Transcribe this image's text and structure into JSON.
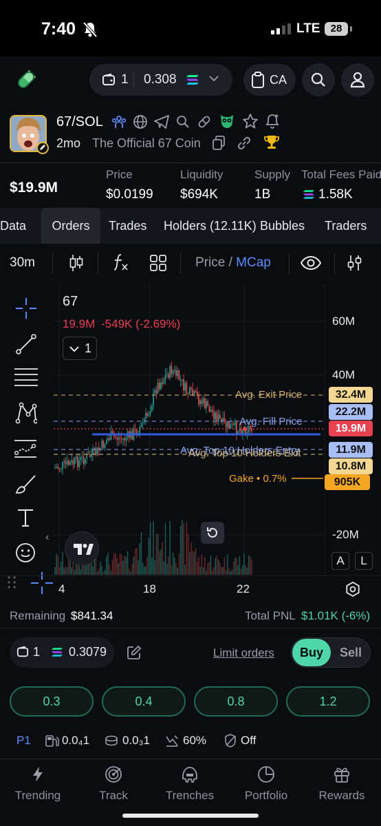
{
  "status_bar": {
    "time": "7:40",
    "network": "LTE",
    "battery": "28"
  },
  "top_bar": {
    "wallet_count": "1",
    "sol_balance": "0.308",
    "ca_label": "CA"
  },
  "token": {
    "pair": "67/SOL",
    "age": "2mo",
    "name": "The Official 67 Coin"
  },
  "stats": {
    "market_cap": "$19.9M",
    "price_label": "Price",
    "price": "$0.0199",
    "liquidity_label": "Liquidity",
    "liquidity": "$694K",
    "supply_label": "Supply",
    "supply": "1B",
    "fees_label": "Total Fees Paid",
    "fees": "1.58K"
  },
  "tabs": [
    "Data",
    "Orders",
    "Trades",
    "Holders (12.11K)",
    "Bubbles",
    "Traders"
  ],
  "toolbar": {
    "interval": "30m",
    "price_label": "Price",
    "slash": "/",
    "mcap_label": "MCap"
  },
  "chart": {
    "symbol": "67",
    "mcap_value": "19.9M",
    "change": "-549K (-2.69%)",
    "indicator_count": "1",
    "y_ticks": [
      "60M",
      "40M",
      "-20M"
    ],
    "x_ticks": [
      "4",
      "18",
      "22"
    ],
    "lines": [
      {
        "label": "Avg. Exit Price",
        "value": "32.4M",
        "color": "#e8c36a"
      },
      {
        "label": "Avg. Fill Price",
        "value": "22.2M",
        "color": "#8aa4f0"
      },
      {
        "label": "",
        "value": "19.9M",
        "color": "#e8414f"
      },
      {
        "label": "Avg. Top 10 Holders Entry",
        "value": "11.9M",
        "color": "#8aa4f0"
      },
      {
        "label": "Avg. Top 10 Holders Exit",
        "value": "10.8M",
        "color": "#f3d792"
      },
      {
        "label": "Gake • 0.7%",
        "value": "905K",
        "color": "#f5a623"
      }
    ],
    "auto_label": "A",
    "log_label": "L"
  },
  "position": {
    "remaining_label": "Remaining",
    "remaining": "$841.34",
    "pnl_label": "Total PNL",
    "pnl": "$1.01K (-6%)"
  },
  "trade": {
    "wallets": "1",
    "balance": "0.3079",
    "limit_orders": "Limit orders",
    "buy": "Buy",
    "sell": "Sell",
    "amounts": [
      "0.3",
      "0.4",
      "0.8",
      "1.2"
    ]
  },
  "settings": {
    "preset": "P1",
    "priority_fee": "0.0₄1",
    "tip": "0.0₃1",
    "slippage": "60%",
    "mev": "Off"
  },
  "nav": [
    "Trending",
    "Track",
    "Trenches",
    "Portfolio",
    "Rewards"
  ],
  "colors": {
    "accent_green": "#4fd6a8",
    "negative": "#e8414f",
    "link_blue": "#5b8cff",
    "gold": "#e3b73c"
  }
}
